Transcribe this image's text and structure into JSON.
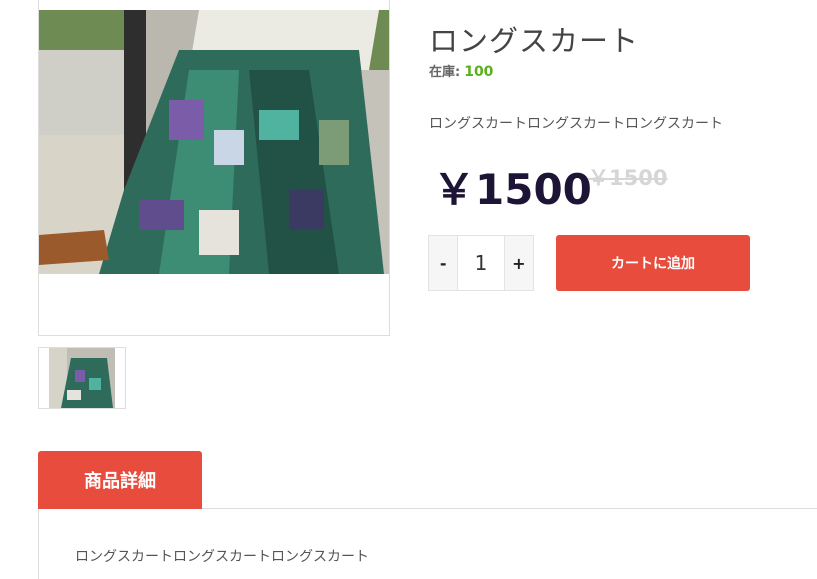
{
  "product": {
    "title": "ロングスカート",
    "stock_label": "在庫:",
    "stock_value": "100",
    "description": "ロングスカートロングスカートロングスカート",
    "price": "￥1500",
    "old_price": "￥1500"
  },
  "cart": {
    "minus_label": "-",
    "quantity": "1",
    "plus_label": "+",
    "add_label": "カートに追加"
  },
  "tabs": {
    "details_label": "商品詳細",
    "details_text": "ロングスカートロングスカートロングスカート"
  },
  "colors": {
    "accent": "#e84c3d",
    "stock": "#5aaf1e",
    "price": "#1e1436"
  }
}
